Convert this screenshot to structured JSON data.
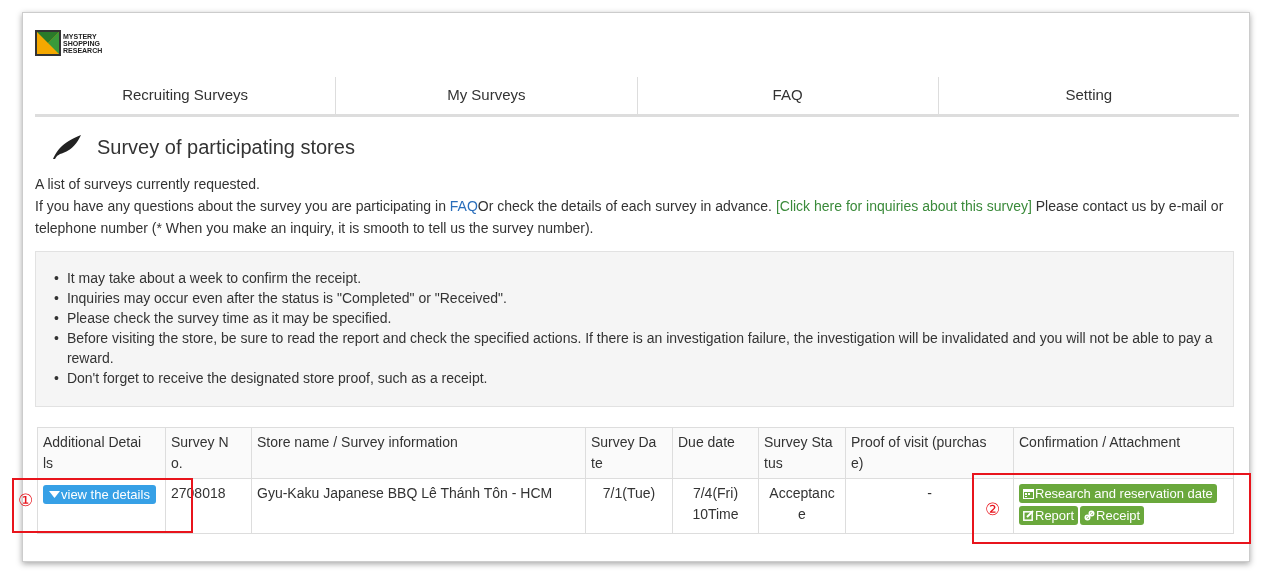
{
  "logo": {
    "lines": [
      "MYSTERY",
      "SHOPPING",
      "RESEARCH"
    ]
  },
  "nav": [
    {
      "label": "Recruiting Surveys"
    },
    {
      "label": "My Surveys"
    },
    {
      "label": "FAQ"
    },
    {
      "label": "Setting"
    }
  ],
  "heading": "Survey of participating stores",
  "intro_line": "A list of surveys currently requested.",
  "intro": {
    "before": "If you have any questions about the survey you are participating in ",
    "faq_link": "FAQ",
    "middle": "Or check the details of each survey in advance. ",
    "inquiry_link": "[Click here for inquiries about this survey]",
    "after": " Please contact us by e-mail or telephone number (* When you make an inquiry, it is smooth to tell us the survey number)."
  },
  "notices": [
    {
      "marker": "•",
      "text": "It may take about a week to confirm the receipt."
    },
    {
      "marker": "•",
      "text": "Inquiries may occur even after the status is \"Completed\" or \"Received\"."
    },
    {
      "marker": "•",
      "text": "Please check the survey time as it may be specified."
    },
    {
      "marker": "•",
      "text": "Before visiting the store, be sure to read the report and check the specified actions. If there is an investigation failure, the investigation will be invalidated and you will not be able to pay a reward."
    },
    {
      "marker": "•",
      "text": "Don't forget to receive the designated store proof, such as a receipt."
    }
  ],
  "table": {
    "columns": [
      [
        "Additional Detai",
        "ls"
      ],
      [
        "Survey N",
        "o."
      ],
      [
        "Store name / Survey information"
      ],
      [
        "Survey Da",
        "te"
      ],
      [
        "Due date"
      ],
      [
        "Survey Sta",
        "tus"
      ],
      [
        "Proof of visit (purchas",
        "e)"
      ],
      [
        "Confirmation / Attachment"
      ]
    ],
    "rows": [
      {
        "details_button": "view the details",
        "survey_no": "2708018",
        "store": "Gyu-Kaku Japanese BBQ Lê Thánh Tôn - HCM",
        "survey_date": "7/1(Tue)",
        "due_date": [
          "7/4(Fri)",
          "10Time"
        ],
        "status": [
          "Acceptanc",
          "e"
        ],
        "proof": "-",
        "actions": [
          {
            "kind": "calendar",
            "label": "Research and reservation date"
          },
          {
            "kind": "edit",
            "label": "Report"
          },
          {
            "kind": "link",
            "label": "Receipt"
          }
        ]
      }
    ]
  },
  "annotations": [
    {
      "label": "①"
    },
    {
      "label": "②"
    }
  ]
}
